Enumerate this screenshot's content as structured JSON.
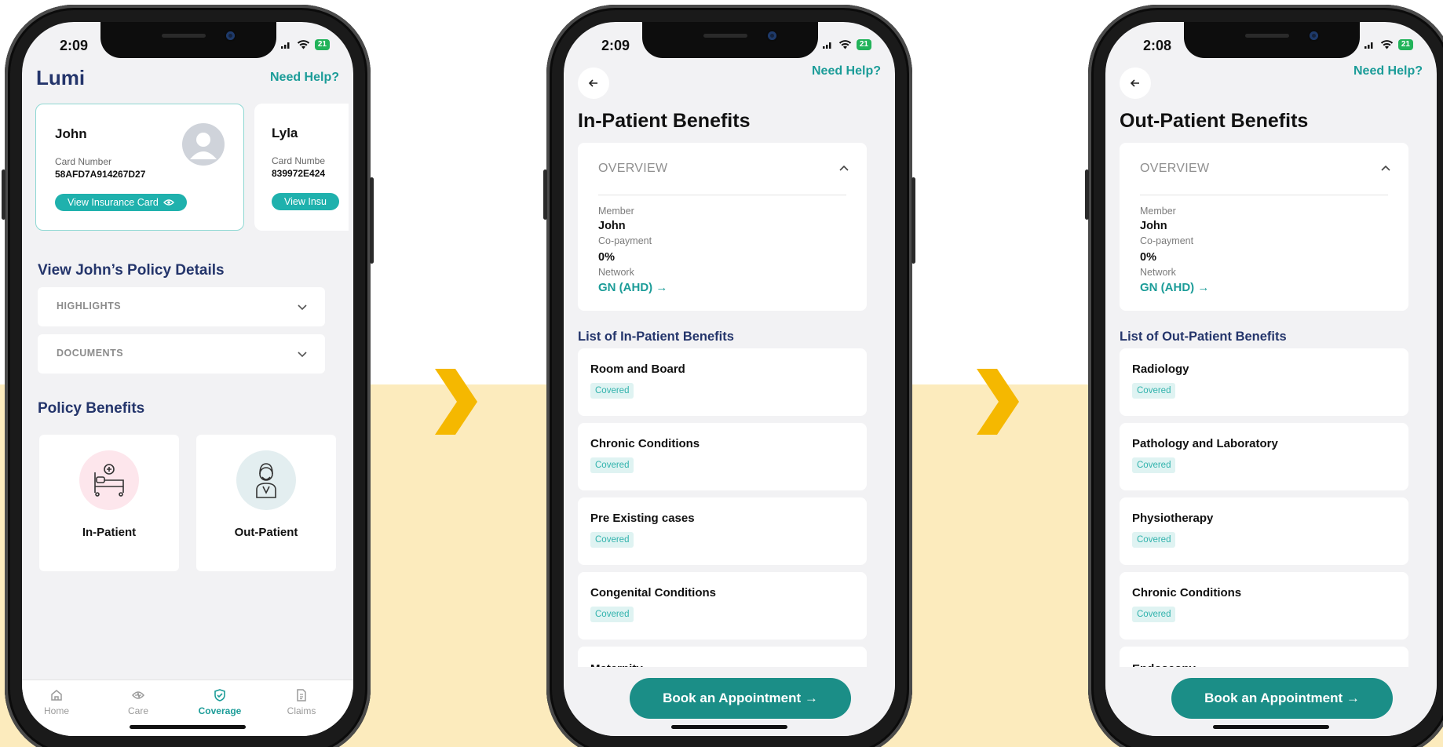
{
  "colors": {
    "accent": "#1b9c98",
    "navy": "#24356b",
    "band": "#fcebbd",
    "arrow": "#f5b800",
    "button": "#1b8e87"
  },
  "phone1": {
    "status": {
      "time": "2:09",
      "battery": "21"
    },
    "app_title": "Lumi",
    "need_help": "Need Help?",
    "members": [
      {
        "name": "John",
        "card_label": "Card Number",
        "card_number": "58AFD7A914267D27",
        "button": "View Insurance Card"
      },
      {
        "name": "Lyla",
        "card_label": "Card Numbe",
        "card_number": "839972E424",
        "button": "View Insu"
      }
    ],
    "policy_title": "View John’s Policy Details",
    "accordions": [
      "HIGHLIGHTS",
      "DOCUMENTS"
    ],
    "benefits_title": "Policy Benefits",
    "benefits": [
      {
        "label": "In-Patient",
        "icon": "hospital-bed-icon"
      },
      {
        "label": "Out-Patient",
        "icon": "patient-mask-icon"
      }
    ],
    "tabs": [
      {
        "label": "Home",
        "icon": "home-icon",
        "active": false
      },
      {
        "label": "Care",
        "icon": "care-icon",
        "active": false
      },
      {
        "label": "Coverage",
        "icon": "shield-icon",
        "active": true
      },
      {
        "label": "Claims",
        "icon": "document-icon",
        "active": false
      }
    ]
  },
  "phone2": {
    "status": {
      "time": "2:09",
      "battery": "21"
    },
    "need_help": "Need Help?",
    "title": "In-Patient Benefits",
    "overview": {
      "heading": "OVERVIEW",
      "member_label": "Member",
      "member_value": "John",
      "copay_label": "Co-payment",
      "copay_value": "0%",
      "network_label": "Network",
      "network_value": "GN (AHD) →"
    },
    "list_title": "List of In-Patient Benefits",
    "items": [
      {
        "name": "Room and Board",
        "status": "Covered"
      },
      {
        "name": "Chronic Conditions",
        "status": "Covered"
      },
      {
        "name": "Pre Existing cases",
        "status": "Covered"
      },
      {
        "name": "Congenital Conditions",
        "status": "Covered"
      }
    ],
    "cut_item": "Maternity",
    "book_button": "Book an Appointment →"
  },
  "phone3": {
    "status": {
      "time": "2:08",
      "battery": "21"
    },
    "need_help": "Need Help?",
    "title": "Out-Patient Benefits",
    "overview": {
      "heading": "OVERVIEW",
      "member_label": "Member",
      "member_value": "John",
      "copay_label": "Co-payment",
      "copay_value": "0%",
      "network_label": "Network",
      "network_value": "GN (AHD) →"
    },
    "list_title": "List of Out-Patient Benefits",
    "items": [
      {
        "name": "Radiology",
        "status": "Covered"
      },
      {
        "name": "Pathology and Laboratory",
        "status": "Covered"
      },
      {
        "name": "Physiotherapy",
        "status": "Covered"
      },
      {
        "name": "Chronic Conditions",
        "status": "Covered"
      }
    ],
    "cut_item": "Endoscopy",
    "book_button": "Book an Appointment →"
  }
}
